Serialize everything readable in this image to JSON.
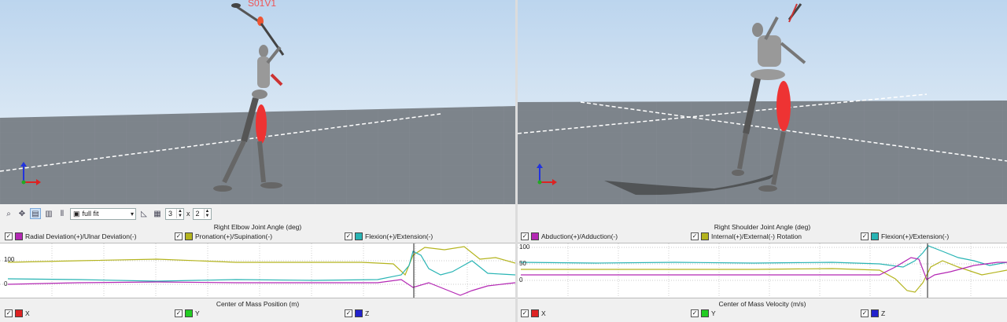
{
  "viewports": {
    "left": {
      "subject_label": "S01V1"
    },
    "right": {}
  },
  "toolbar": {
    "fit_mode": "full fit",
    "rows": "3",
    "times": "x",
    "cols": "2"
  },
  "panels": [
    {
      "title": "Right Elbow Joint Angle (deg)",
      "legend": [
        {
          "label": "Radial Deviation(+)/Ulnar Deviation(-)",
          "color": "#b428b4",
          "checked": true
        },
        {
          "label": "Pronation(+)/Supination(-)",
          "color": "#b4b41e",
          "checked": true
        },
        {
          "label": "Flexion(+)/Extension(-)",
          "color": "#28b4b4",
          "checked": true
        }
      ],
      "yticks": [
        "100",
        "0"
      ]
    },
    {
      "title": "Right Shoulder Joint Angle (deg)",
      "legend": [
        {
          "label": "Abduction(+)/Adduction(-)",
          "color": "#b428b4",
          "checked": true
        },
        {
          "label": "Internal(+)/External(-) Rotation",
          "color": "#b4b41e",
          "checked": true
        },
        {
          "label": "Flexion(+)/Extension(-)",
          "color": "#28b4b4",
          "checked": true
        }
      ],
      "yticks": [
        "100",
        "50",
        "0"
      ]
    },
    {
      "title": "Center of Mass Position (m)",
      "legend": [
        {
          "label": "X",
          "color": "#dd2222",
          "checked": true
        },
        {
          "label": "Y",
          "color": "#22cc22",
          "checked": true
        },
        {
          "label": "Z",
          "color": "#2222cc",
          "checked": true
        }
      ]
    },
    {
      "title": "Center of Mass Velocity (m/s)",
      "legend": [
        {
          "label": "X",
          "color": "#dd2222",
          "checked": true
        },
        {
          "label": "Y",
          "color": "#22cc22",
          "checked": true
        },
        {
          "label": "Z",
          "color": "#2222cc",
          "checked": true
        }
      ]
    }
  ]
}
